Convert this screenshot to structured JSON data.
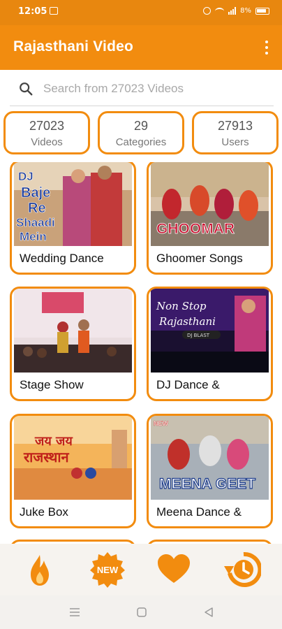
{
  "status_bar": {
    "time": "12:05",
    "battery": "8%"
  },
  "app_bar": {
    "title": "Rajasthani Video",
    "menu_icon": "more-vert-icon"
  },
  "search": {
    "placeholder": "Search from 27023 Videos",
    "icon": "search-icon"
  },
  "stats": [
    {
      "value": "27023",
      "label": "Videos"
    },
    {
      "value": "29",
      "label": "Categories"
    },
    {
      "value": "27913",
      "label": "Users"
    }
  ],
  "categories": [
    {
      "label": "Wedding Dance",
      "thumb_text": "DJ\nBaje\nRe\nShaadi\nMein"
    },
    {
      "label": "Ghoomer Songs",
      "thumb_text": "GHOOMAR"
    },
    {
      "label": "Stage Show",
      "thumb_text": ""
    },
    {
      "label": "DJ Dance &",
      "thumb_text": "Non Stop Rajasthani"
    },
    {
      "label": "Juke Box",
      "thumb_text": "जय जय राजस्थान"
    },
    {
      "label": "Meena Dance &",
      "thumb_text": "MEENA GEET"
    }
  ],
  "bottom_nav": {
    "items": [
      "fire-icon",
      "new-badge-icon",
      "heart-icon",
      "history-icon"
    ],
    "new_label": "NEW"
  },
  "colors": {
    "accent": "#f28c0f",
    "status_bar": "#e8870f"
  }
}
